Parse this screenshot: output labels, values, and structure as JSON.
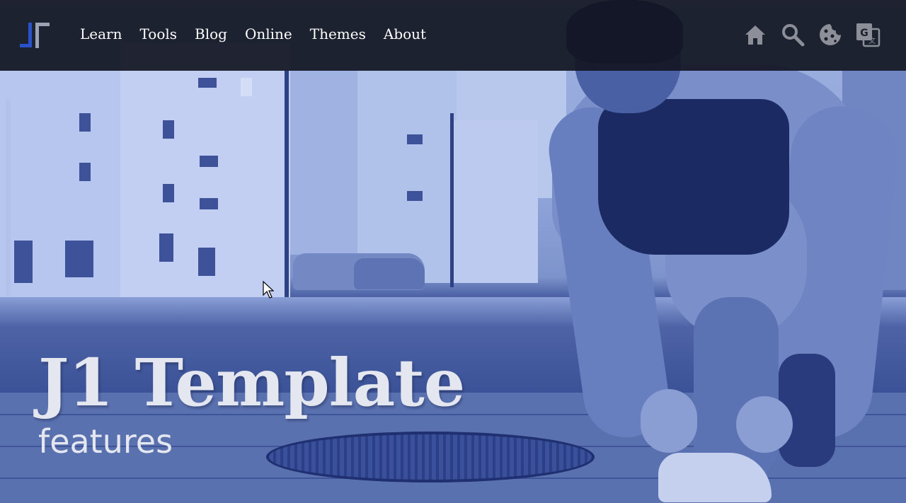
{
  "brand": {
    "logo_icon": "j1-logo-icon"
  },
  "nav": {
    "items": [
      {
        "label": "Learn"
      },
      {
        "label": "Tools"
      },
      {
        "label": "Blog"
      },
      {
        "label": "Online"
      },
      {
        "label": "Themes"
      },
      {
        "label": "About"
      }
    ]
  },
  "toolbar_icons": [
    "home-icon",
    "search-icon",
    "cookie-icon",
    "translate-icon"
  ],
  "hero": {
    "title": "J1 Template",
    "subtitle": "features"
  },
  "colors": {
    "header_bg": "#121622",
    "overlay_blue": "#4a62a6",
    "logo_blue": "#2a52c8",
    "text_light": "#e4e7ef"
  }
}
